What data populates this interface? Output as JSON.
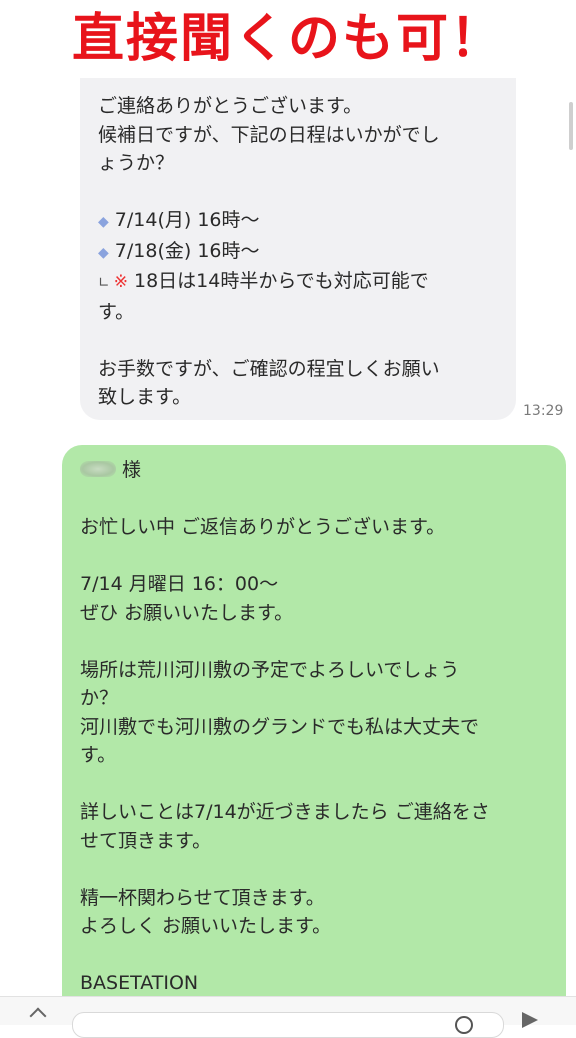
{
  "banner": {
    "text": "直接聞くのも可！"
  },
  "incoming": {
    "line1": "ご連絡ありがとうございます。",
    "line2": "候補日ですが、下記の日程はいかがでし",
    "line3": "ょうか？",
    "opt1": "7/14(月) 16時～",
    "opt2": "7/18(金) 16時～",
    "note1": "18日は14時半からでも対応可能で",
    "note2": "す。",
    "closing1": "お手数ですが、ご確認の程宜しくお願い",
    "closing2": "致します。",
    "time": "13:29"
  },
  "outgoing": {
    "sama": "様",
    "l1": "お忙しい中 ご返信ありがとうございます。",
    "l2": "7/14 月曜日 16：00～",
    "l3": "ぜひ お願いいたします。",
    "l4": "場所は荒川河川敷の予定でよろしいでしょう",
    "l5": "か？",
    "l6": "河川敷でも河川敷のグランドでも私は大丈夫で",
    "l7": "す。",
    "l8": "詳しいことは7/14が近づきましたら ご連絡をさ",
    "l9": "せて頂きます。",
    "l10": "精一杯関わらせて頂きます。",
    "l11": "よろしく お願いいたします。",
    "l12": "BASETATION"
  },
  "colors": {
    "banner": "#e8141b",
    "incoming_bubble": "#f1f1f3",
    "outgoing_bubble": "#b2e8a8",
    "diamond": "#8aa3de"
  }
}
